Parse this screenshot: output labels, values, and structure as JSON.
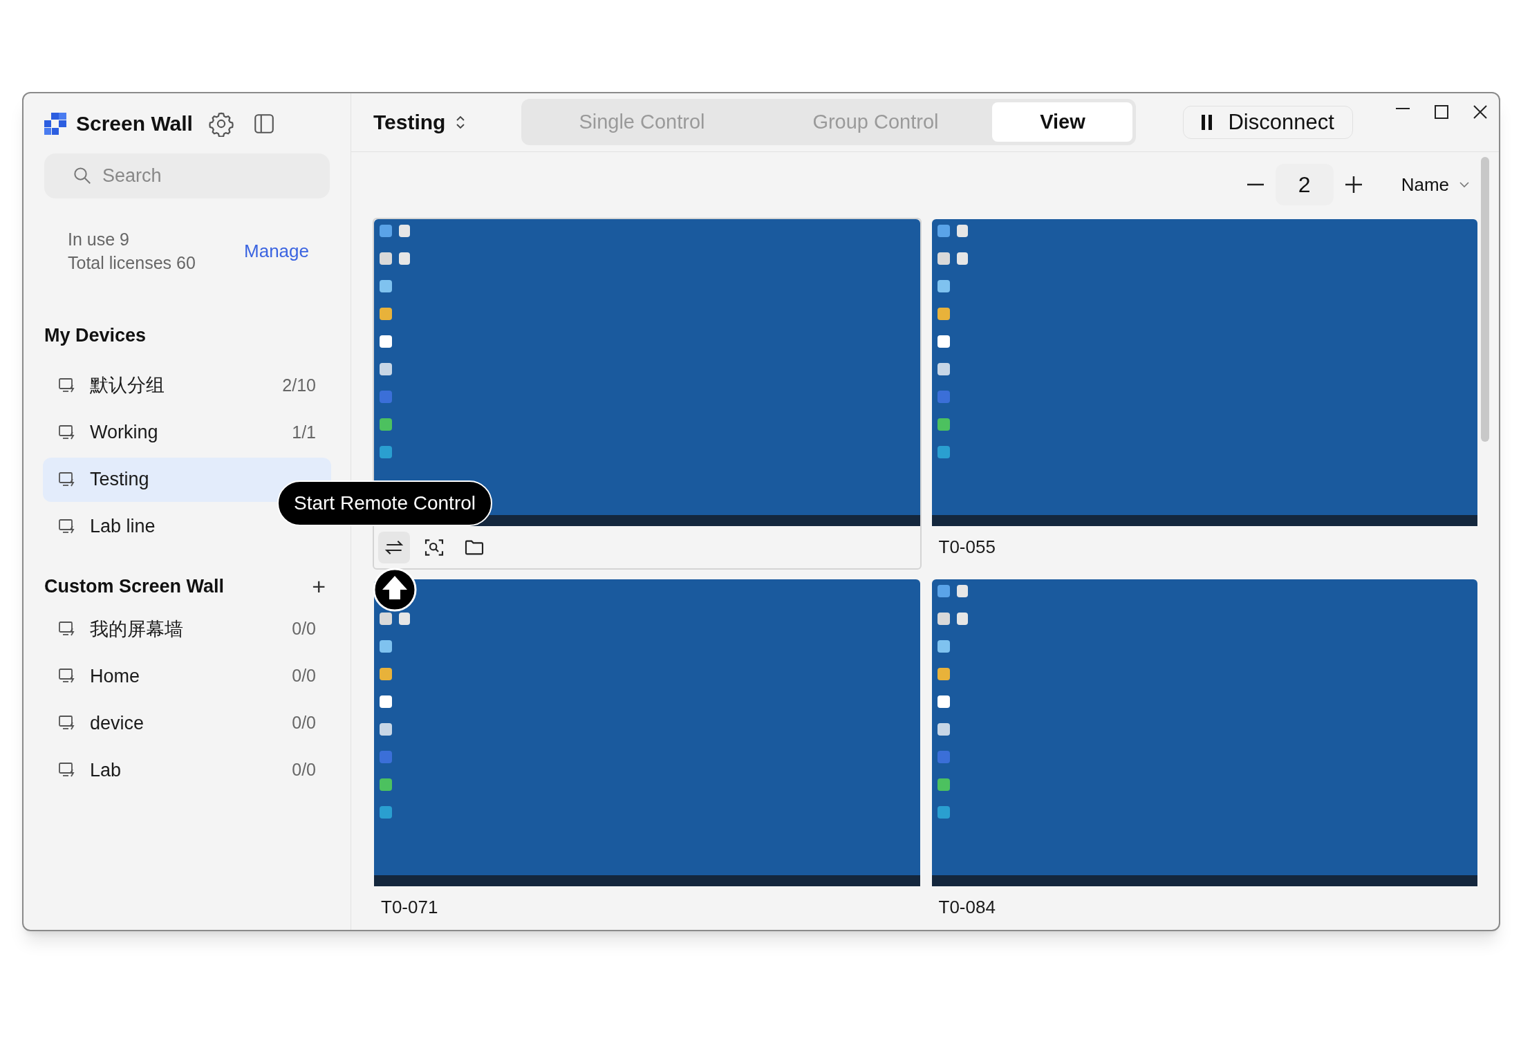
{
  "app": {
    "title": "Screen Wall"
  },
  "search": {
    "placeholder": "Search"
  },
  "licenses": {
    "in_use": "In use 9",
    "total": "Total licenses 60",
    "manage": "Manage"
  },
  "my_devices": {
    "title": "My Devices",
    "groups": [
      {
        "name": "默认分组",
        "count": "2/10",
        "selected": false
      },
      {
        "name": "Working",
        "count": "1/1",
        "selected": false
      },
      {
        "name": "Testing",
        "selected": true
      },
      {
        "name": "Lab line",
        "selected": false
      }
    ]
  },
  "custom_screen_wall": {
    "title": "Custom Screen Wall",
    "add": "+",
    "walls": [
      {
        "name": "我的屏幕墙",
        "count": "0/0",
        "selected": false
      },
      {
        "name": "Home",
        "count": "0/0",
        "selected": false
      },
      {
        "name": "device",
        "count": "0/0",
        "selected": false
      },
      {
        "name": "Lab",
        "count": "0/0",
        "selected": false
      }
    ]
  },
  "header": {
    "group": "Testing",
    "tabs": [
      {
        "label": "Single Control",
        "selected": false
      },
      {
        "label": "Group Control",
        "selected": false
      },
      {
        "label": "View",
        "selected": true
      }
    ],
    "disconnect": "Disconnect"
  },
  "controls": {
    "columns": "2",
    "sort": "Name"
  },
  "devices": [
    {
      "hovered": true,
      "tools": [
        {
          "kind": "swap",
          "active": true
        },
        {
          "kind": "screenshot",
          "active": false
        },
        {
          "kind": "folder",
          "active": false
        }
      ]
    },
    {
      "name": "T0-055",
      "hovered": false
    },
    {
      "name": "T0-071",
      "hovered": false
    },
    {
      "name": "T0-084",
      "hovered": false
    }
  ],
  "tooltip": {
    "text": "Start Remote Control"
  }
}
